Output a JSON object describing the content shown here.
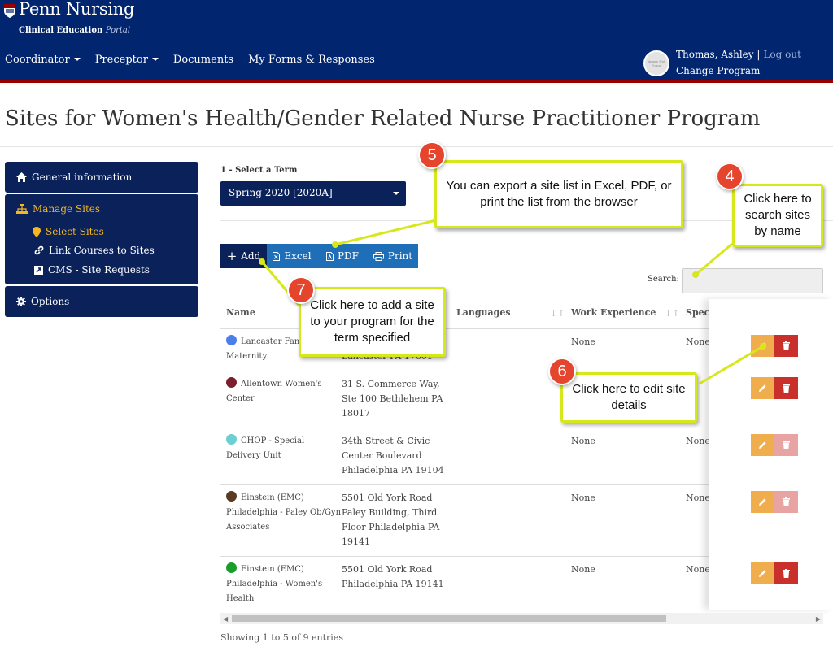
{
  "header": {
    "logo_text": "Penn Nursing",
    "logo_sub_bold": "Clinical Education ",
    "logo_sub_italic": "Portal",
    "nav": [
      {
        "label": "Coordinator"
      },
      {
        "label": "Preceptor"
      },
      {
        "label": "Documents"
      },
      {
        "label": "My Forms & Responses"
      }
    ],
    "user_name": "Thomas, Ashley",
    "separator": "|",
    "logout": "Log out",
    "change_program": "Change Program",
    "avatar_text": "Image Not Found"
  },
  "page_title": "Sites for Women's Health/Gender Related Nurse Practitioner Program",
  "sidebar": {
    "general_information": "General information",
    "manage_sites": "Manage Sites",
    "select_sites": "Select Sites",
    "link_courses": "Link Courses to Sites",
    "cms_requests": "CMS - Site Requests",
    "options": "Options"
  },
  "term": {
    "label": "1 - Select a Term",
    "value": "Spring 2020 [2020A]"
  },
  "toolbar": {
    "add": "Add",
    "excel": "Excel",
    "pdf": "PDF",
    "print": "Print"
  },
  "search": {
    "label": "Search:",
    "placeholder": ""
  },
  "table": {
    "headers": {
      "name": "Name",
      "languages": "Languages",
      "work_experience": "Work Experience",
      "specialty": "Speci"
    },
    "rows": [
      {
        "name1": "Lancaster Famil",
        "name2": "Maternity",
        "addr1": "",
        "addr2": "Lancaster PA 17601",
        "addr3": "",
        "addr4": "",
        "work": "None",
        "spec": "None",
        "dot": "#4a7ee8",
        "delete_disabled": false
      },
      {
        "name1": "Allentown Women's",
        "name2": "Center",
        "addr1": "31 S. Commerce Way,",
        "addr2": "Ste 100 Bethlehem PA",
        "addr3": "18017",
        "addr4": "",
        "work": "",
        "spec": "ne",
        "dot": "#7a1f2b",
        "delete_disabled": false
      },
      {
        "name1": "CHOP - Special",
        "name2": "Delivery Unit",
        "addr1": "34th Street & Civic",
        "addr2": "Center Boulevard",
        "addr3": "Philadelphia PA 19104",
        "addr4": "",
        "work": "None",
        "spec": "None",
        "dot": "#6ccfd1",
        "delete_disabled": true
      },
      {
        "name1": "Einstein (EMC)",
        "name2": "Philadelphia - Paley Ob/Gyn",
        "name3": "Associates",
        "addr1": "5501 Old York Road",
        "addr2": "Paley Building, Third",
        "addr3": "Floor Philadelphia PA",
        "addr4": "19141",
        "work": "None",
        "spec": "None",
        "dot": "#5a3a22",
        "delete_disabled": true
      },
      {
        "name1": "Einstein (EMC)",
        "name2": "Philadelphia - Women's",
        "name3": "Health",
        "addr1": "5501 Old York Road",
        "addr2": "Philadelphia PA 19141",
        "addr3": "",
        "addr4": "",
        "work": "None",
        "spec": "None",
        "dot": "#1a9e2a",
        "delete_disabled": false
      }
    ]
  },
  "footer_info": "Showing 1 to 5 of 9 entries",
  "callouts": {
    "c4": {
      "number": "4",
      "text": "Click here to search sites by name"
    },
    "c5": {
      "number": "5",
      "text": "You can export a site list in Excel, PDF, or print the list from the browser"
    },
    "c6": {
      "number": "6",
      "text": "Click here to edit site details"
    },
    "c7": {
      "number": "7",
      "text": "Click here to add a site to your program for the term specified"
    }
  },
  "colors": {
    "header_bg": "#01256e",
    "accent_red": "#990000",
    "sidebar_bg": "#0a2159",
    "active_yellow": "#f5b720",
    "callout_border": "#d7e81a",
    "badge_red": "#e4452c"
  }
}
